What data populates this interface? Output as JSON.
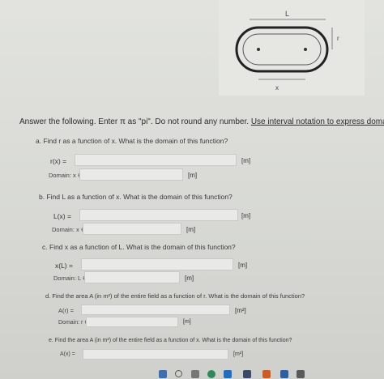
{
  "diagram": {
    "label_L": "L",
    "label_r": "r",
    "label_x": "x"
  },
  "instructions": {
    "pre": "Answer the following. Enter π as \"pi\". Do not round any number.",
    "highlight": "Use interval notation to express domains."
  },
  "questions": [
    {
      "letter": "a.",
      "text": "Find r as a function of x. What is the domain of this function?",
      "func_label": "r(x) =",
      "unit": "[m]",
      "domain_label": "Domain: x ∈",
      "domain_unit": "[m]"
    },
    {
      "letter": "b.",
      "text": "Find L as a function of x. What is the domain of this function?",
      "func_label": "L(x) =",
      "unit": "[m]",
      "domain_label": "Domain: x ∈",
      "domain_unit": "[m]"
    },
    {
      "letter": "c.",
      "text": "Find x as a function of L. What is the domain of this function?",
      "func_label": "x(L) =",
      "unit": "[m]",
      "domain_label": "Domain: L ∈",
      "domain_unit": "[m]"
    },
    {
      "letter": "d.",
      "text": "Find the area A (in m²) of the entire field as a function of r. What is the domain of this function?",
      "func_label": "A(r) =",
      "unit": "[m²]",
      "domain_label": "Domain: r ∈",
      "domain_unit": "[m]"
    },
    {
      "letter": "e.",
      "text": "Find the area A (in m²) of the entire field as a function of x. What is the domain of this function?",
      "func_label": "A(x) =",
      "unit": "[m²]"
    }
  ],
  "taskbar": {
    "icons": [
      "windows-icon",
      "search-icon",
      "files-icon",
      "browser-icon",
      "mail-icon",
      "store-icon",
      "app-icon-1",
      "app-icon-2",
      "app-icon-3"
    ]
  }
}
